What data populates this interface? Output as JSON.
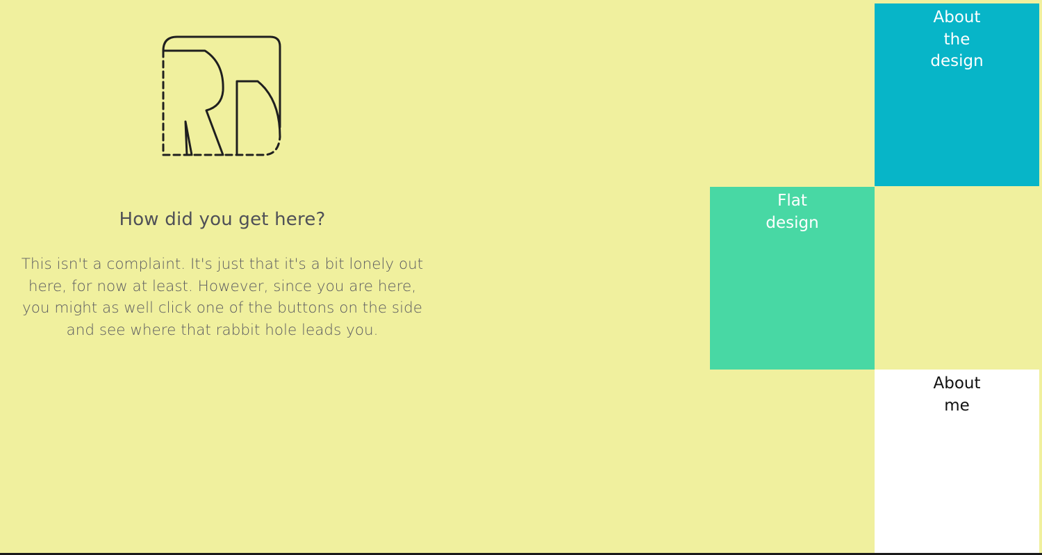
{
  "colors": {
    "background": "#f0f09e",
    "about_design_tile": "#07b5c8",
    "flat_design_tile": "#48d8a4",
    "about_me_tile": "#ffffff",
    "heading_text": "#4f5057"
  },
  "logo": {
    "icon": "rd-monogram-logo"
  },
  "main": {
    "heading": "How did you get here?",
    "intro": "This isn't a complaint. It's just that it's a bit lonely out here, for now at least. However, since you are here, you might as well click one of the buttons on the side and see where that rabbit hole leads you."
  },
  "nav": {
    "about_design": "About the design",
    "flat_design": "Flat design",
    "about_me": "About me"
  }
}
